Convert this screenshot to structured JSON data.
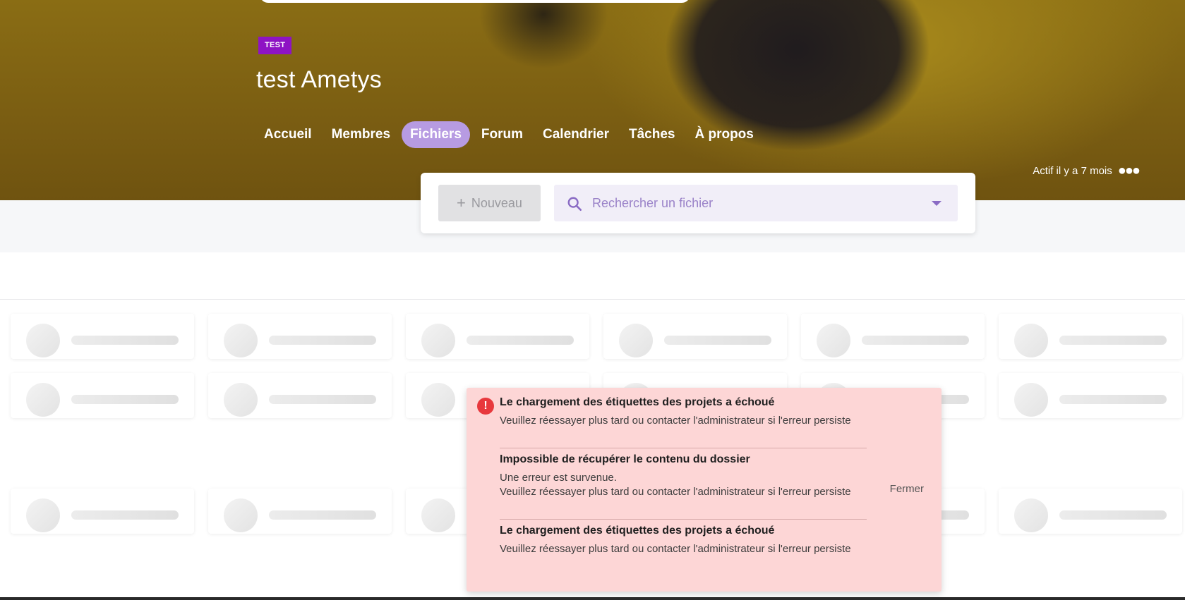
{
  "hero": {
    "badge": "TEST",
    "title": "test Ametys",
    "tabs": [
      "Accueil",
      "Membres",
      "Fichiers",
      "Forum",
      "Calendrier",
      "Tâches",
      "À propos"
    ],
    "active_tab": "Fichiers",
    "activity": "Actif il y a 7 mois",
    "more_icon": "more-dots-icon"
  },
  "toolbar": {
    "new_label": "Nouveau",
    "new_icon": "plus-icon",
    "search_placeholder": "Rechercher un fichier",
    "search_value": "",
    "search_icon": "search-icon",
    "dropdown_icon": "caret-down-icon"
  },
  "notification": {
    "icon": "error-icon",
    "close_label": "Fermer",
    "messages": [
      {
        "title": "Le chargement des étiquettes des projets a échoué",
        "lines": [
          "Veuillez réessayer plus tard ou contacter l'administrateur si l'erreur persiste"
        ]
      },
      {
        "title": "Impossible de récupérer le contenu du dossier",
        "lines": [
          "Une erreur est survenue.",
          "Veuillez réessayer plus tard ou contacter l'administrateur si l'erreur persiste"
        ]
      },
      {
        "title": "Le chargement des étiquettes des projets a échoué",
        "lines": [
          "Veuillez réessayer plus tard ou contacter l'administrateur si l'erreur persiste"
        ]
      }
    ]
  },
  "colors": {
    "accent": "#b79be2",
    "badge": "#8e13c4",
    "error": "#e8383d",
    "notification_bg": "#fdd6d6"
  }
}
